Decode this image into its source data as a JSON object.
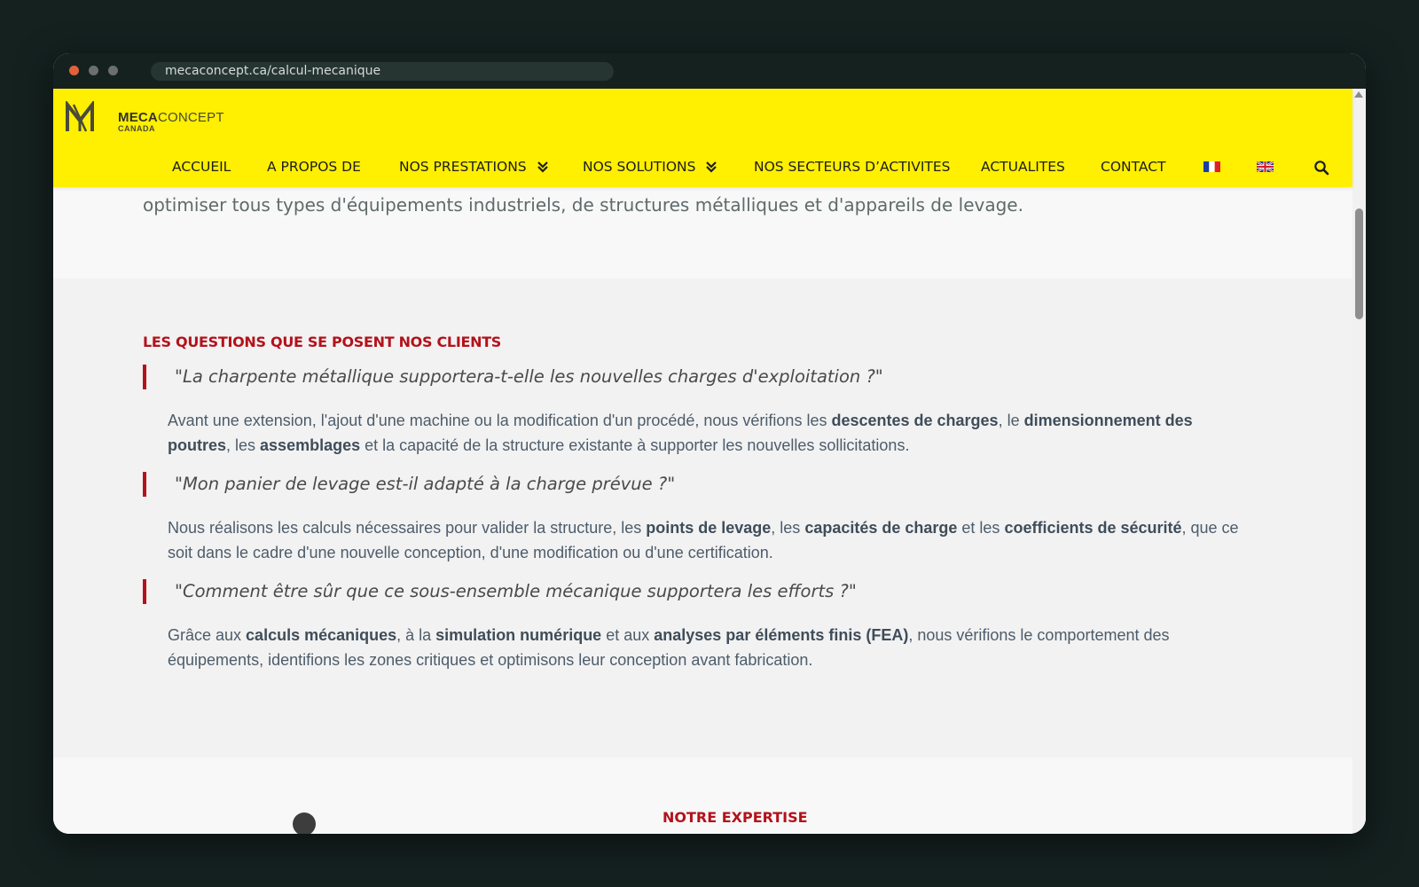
{
  "browser": {
    "url": "mecaconcept.ca/calcul-mecanique"
  },
  "logo": {
    "name_bold": "MECA",
    "name_rest": "CONCEPT",
    "sub": "CANADA"
  },
  "nav": {
    "items": [
      {
        "label": "ACCUEIL"
      },
      {
        "label": "A PROPOS DE"
      },
      {
        "label": "NOS PRESTATIONS"
      },
      {
        "label": "NOS SOLUTIONS"
      },
      {
        "label": "NOS SECTEURS D’ACTIVITES"
      },
      {
        "label": "ACTUALITES"
      },
      {
        "label": "CONTACT"
      }
    ],
    "flags": [
      "flag-fr-icon",
      "flag-uk-icon"
    ]
  },
  "intro": {
    "line2": "optimiser tous types d'équipements industriels, de structures métalliques et d'appareils de levage."
  },
  "qa": {
    "title": "LES QUESTIONS QUE SE POSENT NOS CLIENTS",
    "items": [
      {
        "question": "\"La charpente métallique supportera-t-elle les nouvelles charges d'exploitation ?\"",
        "answer": [
          {
            "t": "Avant une extension, l'ajout d'une machine ou la modification d'un procédé, nous vérifions les ",
            "b": false
          },
          {
            "t": "descentes de charges",
            "b": true
          },
          {
            "t": ", le ",
            "b": false
          },
          {
            "t": "dimensionnement des poutres",
            "b": true
          },
          {
            "t": ", les ",
            "b": false
          },
          {
            "t": "assemblages",
            "b": true
          },
          {
            "t": " et la capacité de la structure existante à supporter les nouvelles sollicitations.",
            "b": false
          }
        ]
      },
      {
        "question": "\"Mon panier de levage est-il adapté à la charge prévue ?\"",
        "answer": [
          {
            "t": "Nous réalisons les calculs nécessaires pour valider la structure, les ",
            "b": false
          },
          {
            "t": "points de levage",
            "b": true
          },
          {
            "t": ", les ",
            "b": false
          },
          {
            "t": "capacités de charge",
            "b": true
          },
          {
            "t": " et les ",
            "b": false
          },
          {
            "t": "coefficients de sécurité",
            "b": true
          },
          {
            "t": ", que ce soit dans le cadre d'une nouvelle conception, d'une modification ou d'une certification.",
            "b": false
          }
        ]
      },
      {
        "question": "\"Comment être sûr que ce sous-ensemble mécanique supportera les efforts ?\"",
        "answer": [
          {
            "t": "Grâce aux ",
            "b": false
          },
          {
            "t": "calculs mécaniques",
            "b": true
          },
          {
            "t": ", à la ",
            "b": false
          },
          {
            "t": "simulation numérique",
            "b": true
          },
          {
            "t": " et aux ",
            "b": false
          },
          {
            "t": "analyses par éléments finis (FEA)",
            "b": true
          },
          {
            "t": ", nous vérifions le comportement des équipements, identifions les zones critiques et optimisons leur conception avant fabrication.",
            "b": false
          }
        ]
      }
    ]
  },
  "next_section": {
    "title": "NOTRE EXPERTISE"
  },
  "colors": {
    "header_bg": "#ffef00",
    "accent_red": "#b3121b",
    "section_bg": "#f2f2f2"
  }
}
